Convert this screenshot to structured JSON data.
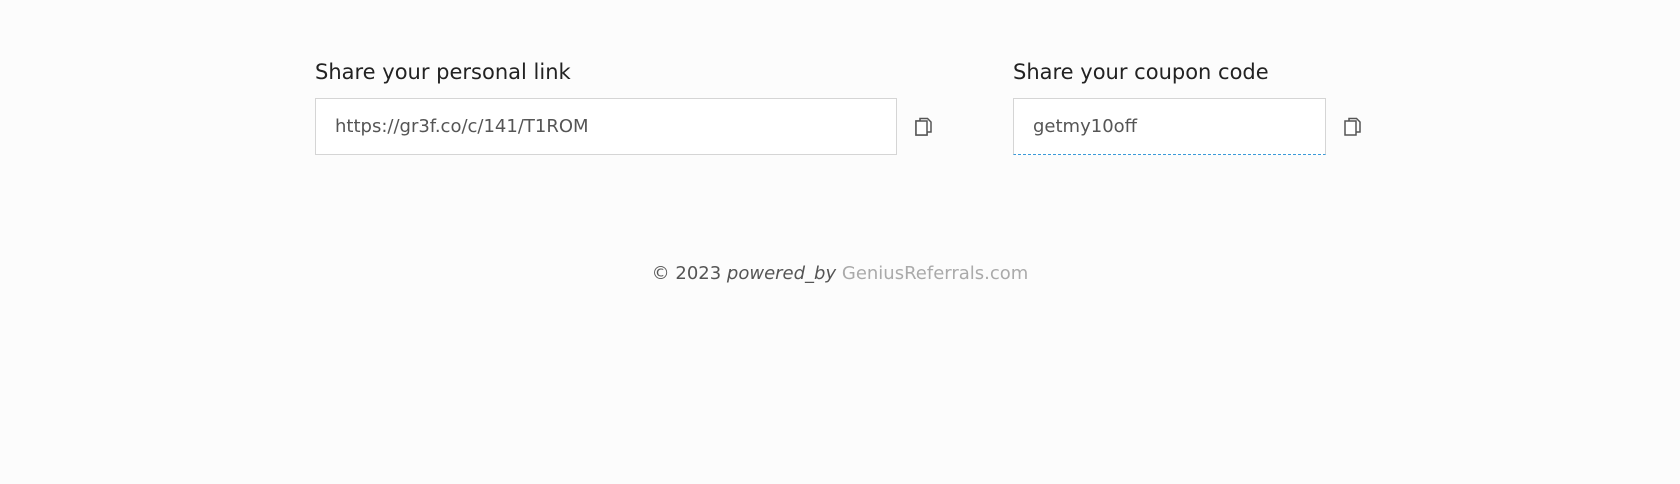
{
  "personal_link": {
    "title": "Share your personal link",
    "value": "https://gr3f.co/c/141/T1ROM",
    "copy_icon": "copy-icon"
  },
  "coupon_code": {
    "title": "Share your coupon code",
    "value": "getmy10off",
    "copy_icon": "copy-icon",
    "focus_color": "#3a9ad9"
  },
  "footer": {
    "copyright": "© 2023",
    "powered_by": "powered_by",
    "link_text": "GeniusReferrals.com"
  },
  "colors": {
    "background": "#fcfcfc",
    "input_border": "#d5d5d5",
    "footer_link": "#aaaaaa"
  }
}
